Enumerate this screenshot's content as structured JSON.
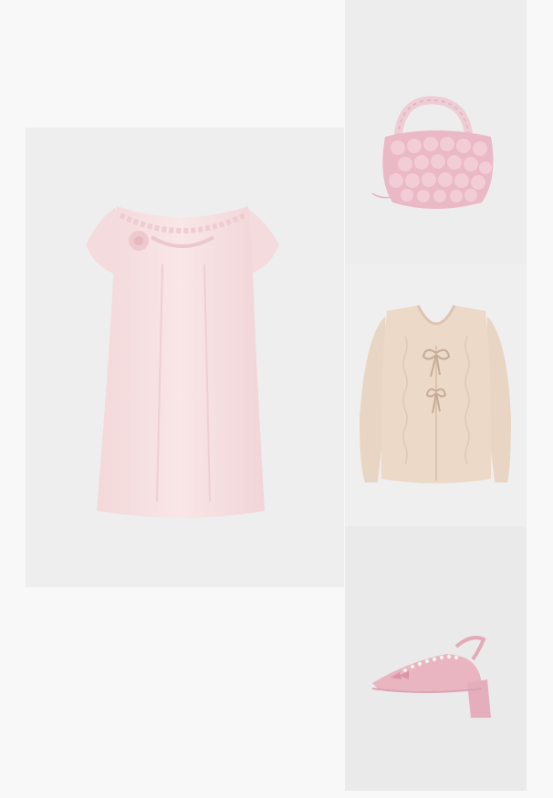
{
  "page": {
    "background": "#f8f8f8"
  },
  "products": [
    {
      "id": "dress",
      "kind": "dress",
      "color": "#f6dfe0",
      "tile_bg": "#efeeee"
    },
    {
      "id": "bag",
      "kind": "pom-pom handbag",
      "color": "#eab9c5",
      "tile_bg": "#eeeded"
    },
    {
      "id": "cardigan",
      "kind": "tie-front knit cardigan",
      "color": "#ecd9c8",
      "tile_bg": "#efefef"
    },
    {
      "id": "shoe",
      "kind": "slingback block-heel pump",
      "color": "#e8b5c0",
      "tile_bg": "#ebeaea"
    }
  ]
}
